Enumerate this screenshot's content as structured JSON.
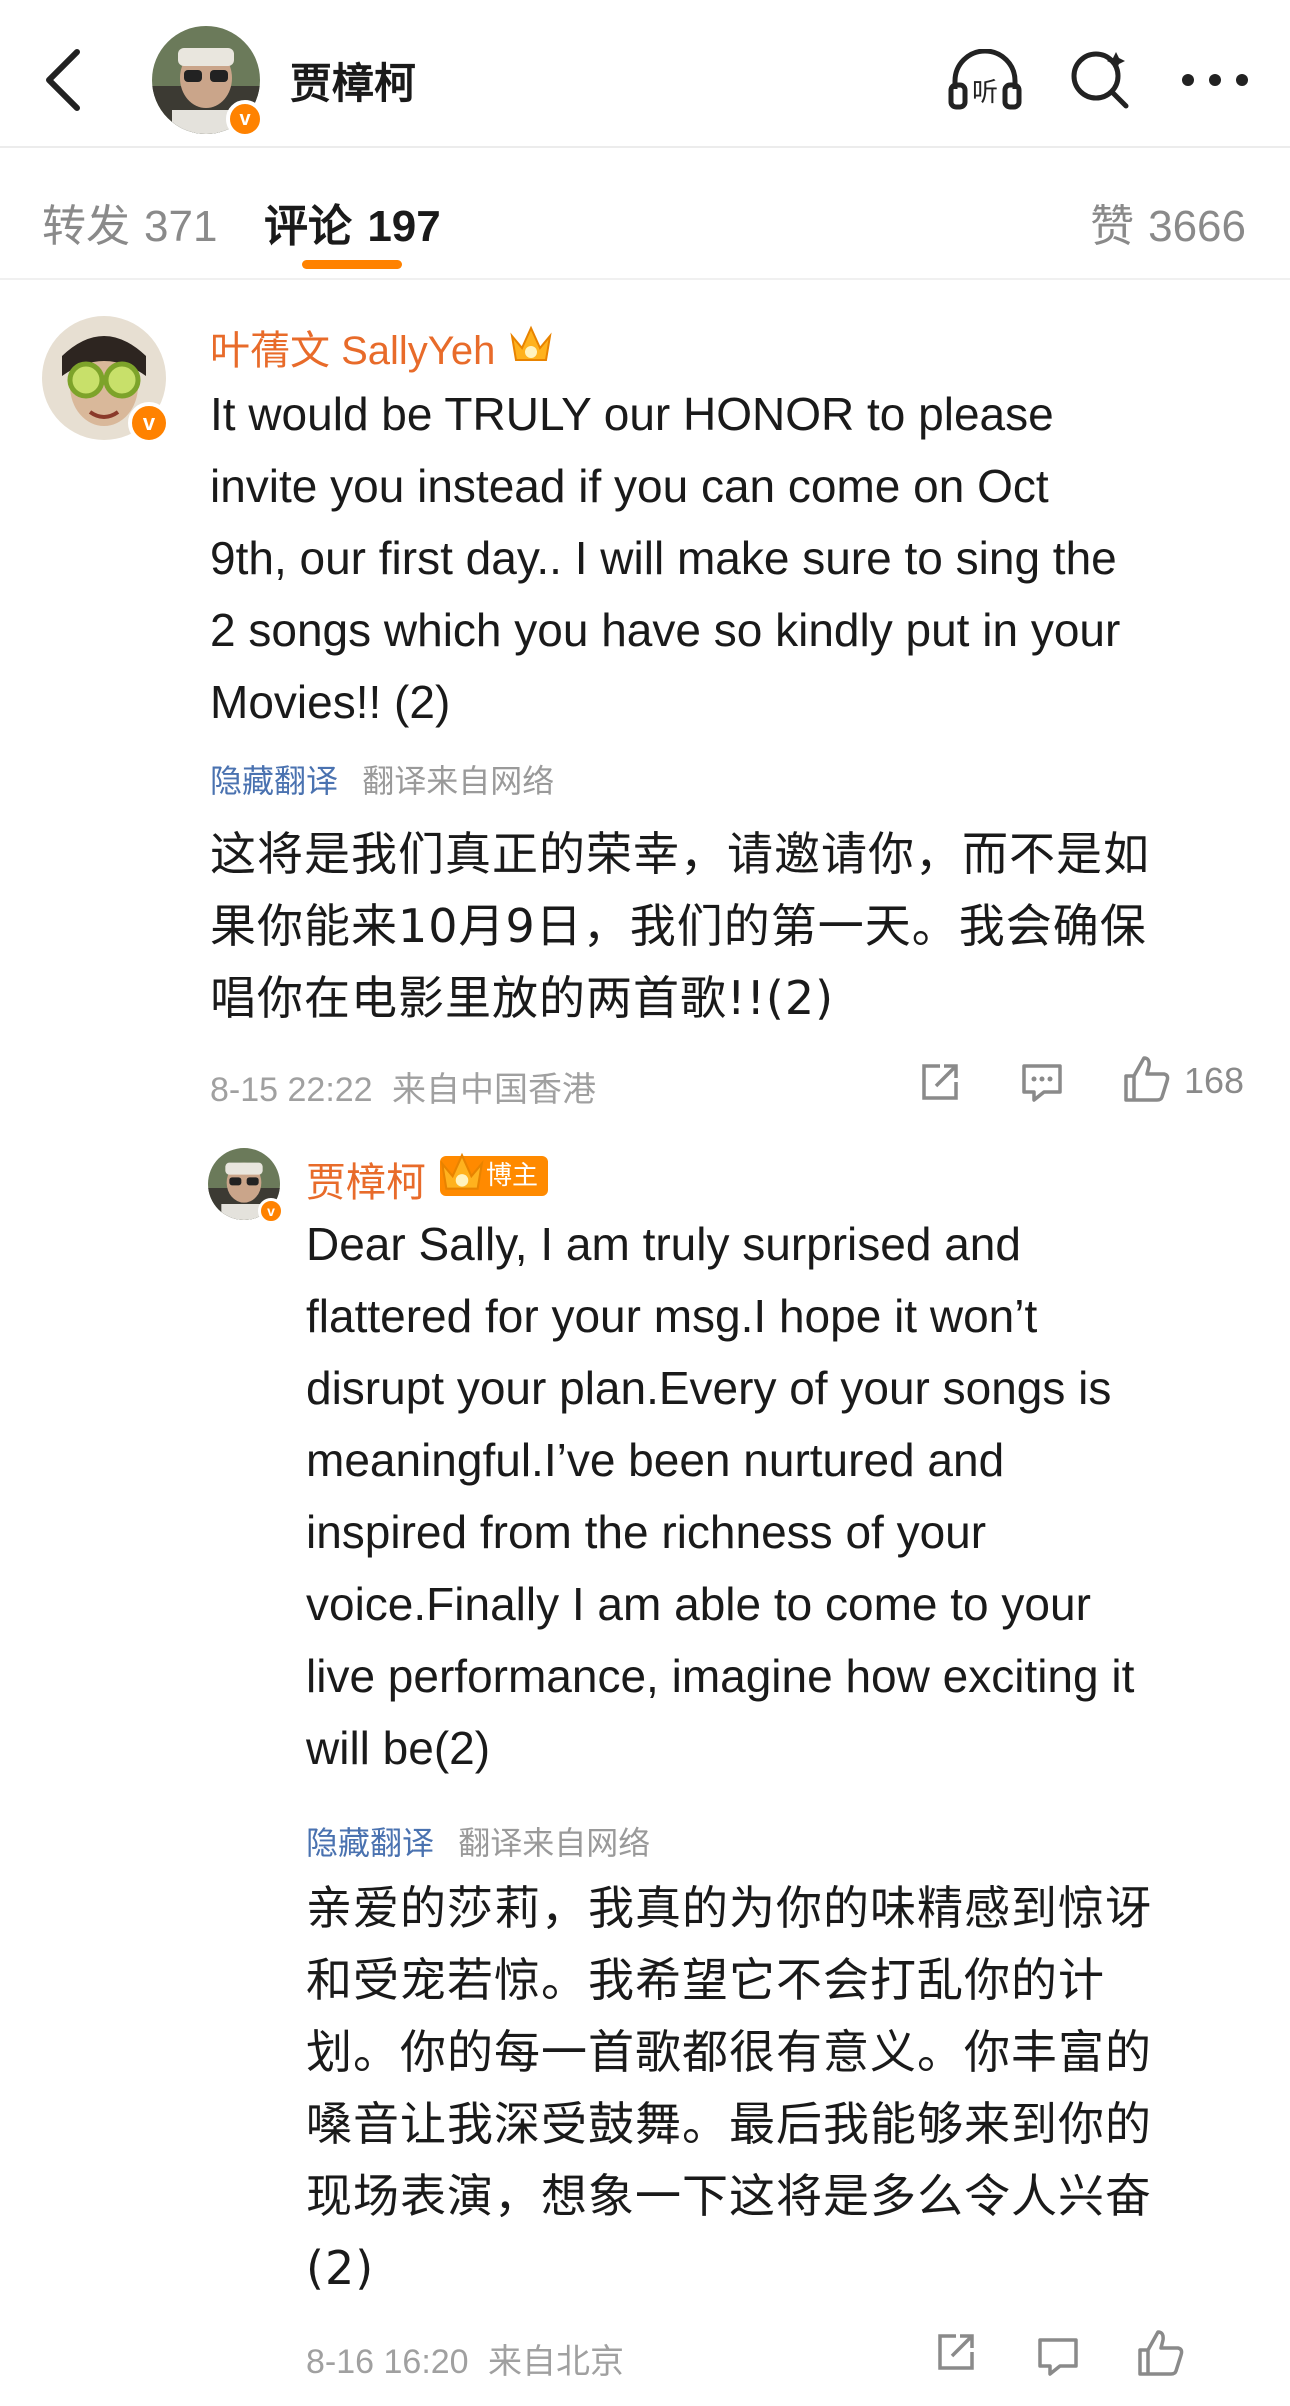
{
  "header": {
    "title": "贾樟柯"
  },
  "tabs": {
    "repost_label": "转发",
    "repost_count": "371",
    "comment_label": "评论",
    "comment_count": "197",
    "like_label": "赞",
    "like_count": "3666"
  },
  "comment": {
    "author": "叶蒨文 SallyYeh",
    "text_lines": [
      "It would be TRULY our HONOR to please",
      "invite you instead if you can come on Oct",
      "9th, our first day.. I will make sure to sing the",
      "2 songs which you have so kindly put in your",
      "Movies!!  (2)"
    ],
    "hide_translation": "隐藏翻译",
    "translation_source": "翻译来自网络",
    "translated_lines": [
      "这将是我们真正的荣幸，请邀请你，而不是如",
      "果你能来10月9日，我们的第一天。我会确保",
      "唱你在电影里放的两首歌!!(2)"
    ],
    "date": "8-15 22:22",
    "location": "来自中国香港",
    "likes": "168"
  },
  "reply": {
    "author": "贾樟柯",
    "badge": "博主",
    "text_lines": [
      "Dear Sally, I am truly surprised and",
      "flattered for your msg.I hope it won’t",
      "disrupt your plan.Every of your songs is",
      "meaningful.I’ve been nurtured and",
      "inspired from the richness of your",
      "voice.Finally I am able to come to your",
      "live performance, imagine how exciting it",
      "will be(2)"
    ],
    "hide_translation": "隐藏翻译",
    "translation_source": "翻译来自网络",
    "translated_lines": [
      "亲爱的莎莉，我真的为你的味精感到惊讶",
      "和受宠若惊。我希望它不会打乱你的计",
      "划。你的每一首歌都很有意义。你丰富的",
      "嗓音让我深受鼓舞。最后我能够来到你的",
      "现场表演，想象一下这将是多么令人兴奋",
      "(2)"
    ],
    "date": "8-16 16:20",
    "location": "来自北京"
  },
  "colors": {
    "accent": "#ff8200",
    "author": "#e86b2a",
    "link": "#4a72b0",
    "meta": "#a0a0a0"
  },
  "icons": [
    "back-arrow-icon",
    "listen-icon",
    "search-icon",
    "more-icon",
    "share-icon",
    "comment-icon",
    "thumbs-up-icon",
    "verified-icon",
    "crown-icon"
  ]
}
